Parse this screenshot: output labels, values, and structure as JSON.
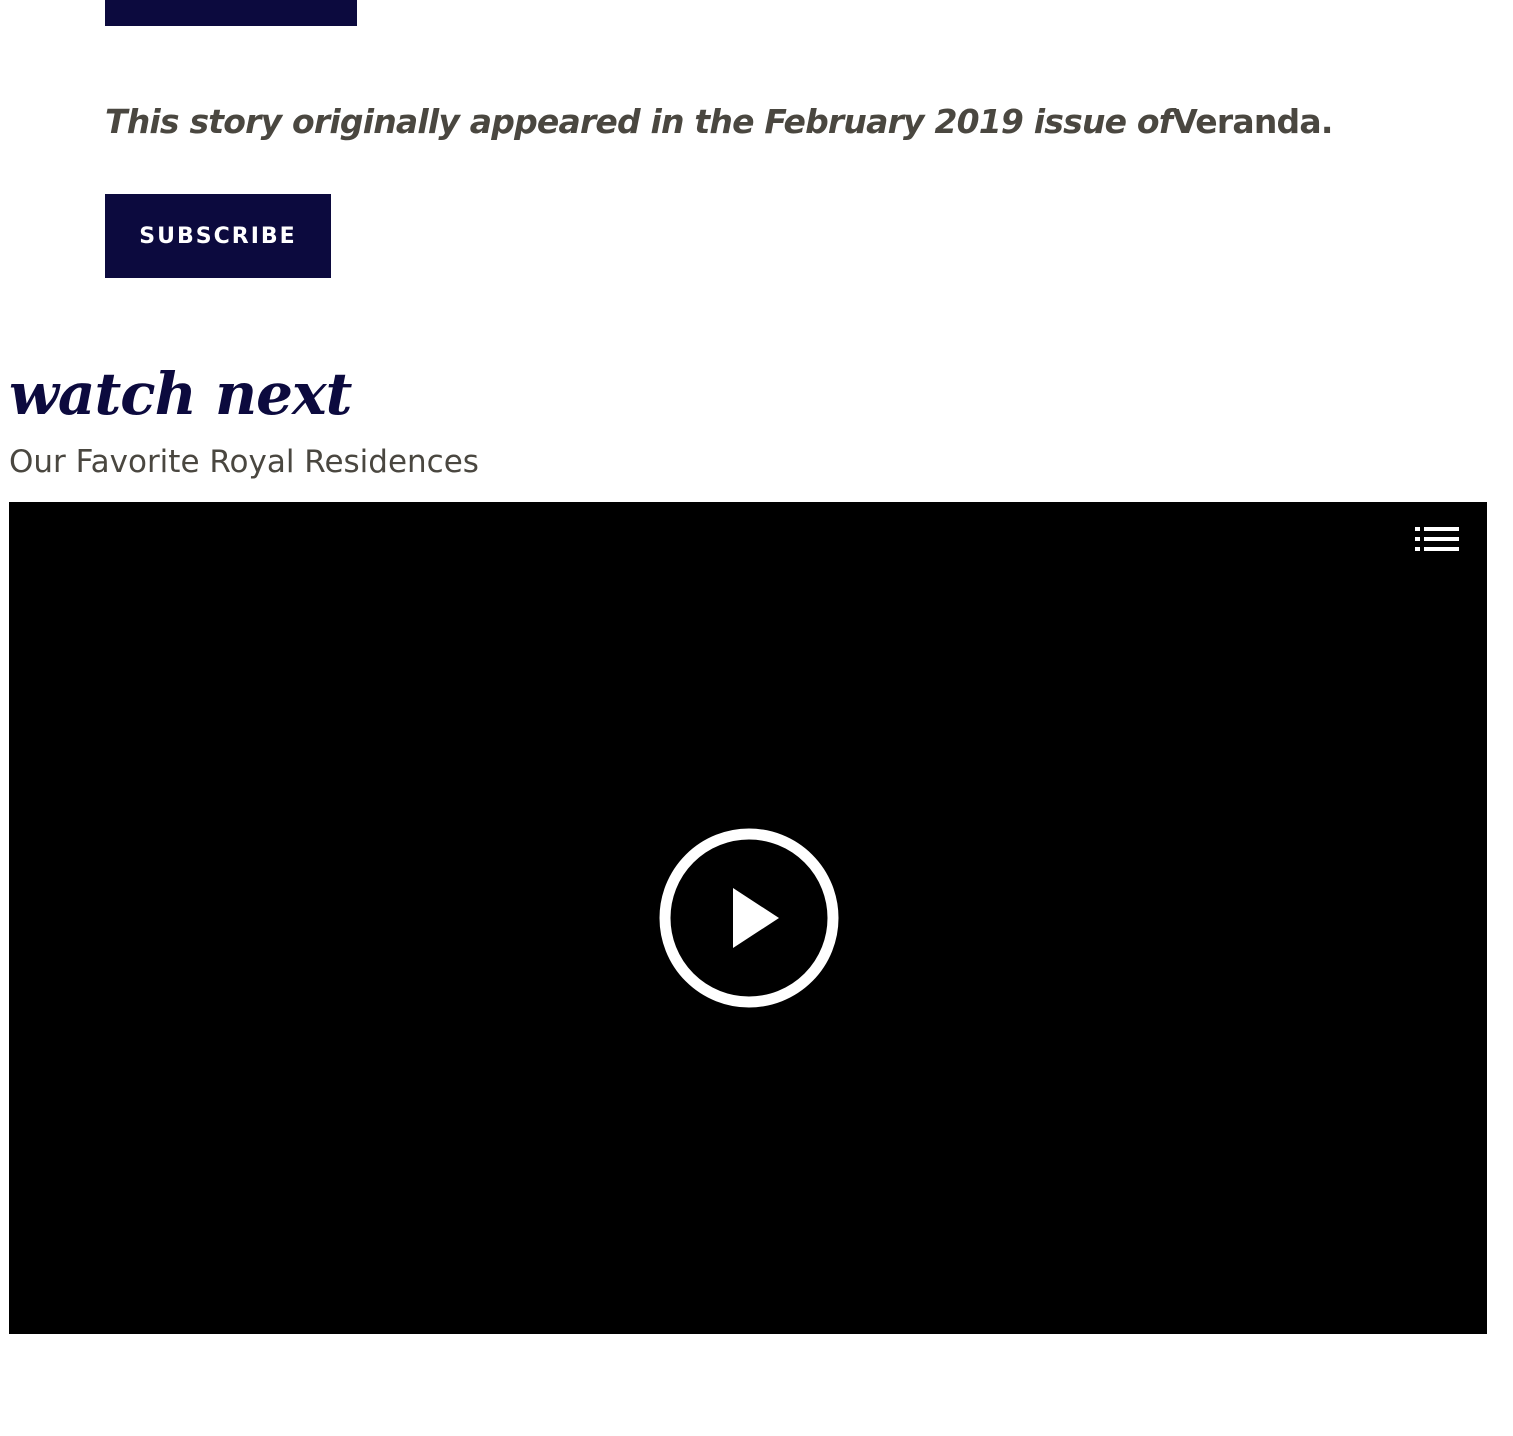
{
  "article_footer": {
    "credit_italic": "This story originally appeared in the February 2019 issue of",
    "credit_publication": "Veranda.",
    "subscribe_label": "SUBSCRIBE"
  },
  "watch_next": {
    "heading": "watch next",
    "video_title": "Our Favorite Royal Residences"
  },
  "player": {
    "playlist_icon": "playlist-icon",
    "play_icon": "play-icon"
  },
  "colors": {
    "brand_navy": "#0c0a3e",
    "body_text": "#4a4740",
    "player_bg": "#000000"
  }
}
